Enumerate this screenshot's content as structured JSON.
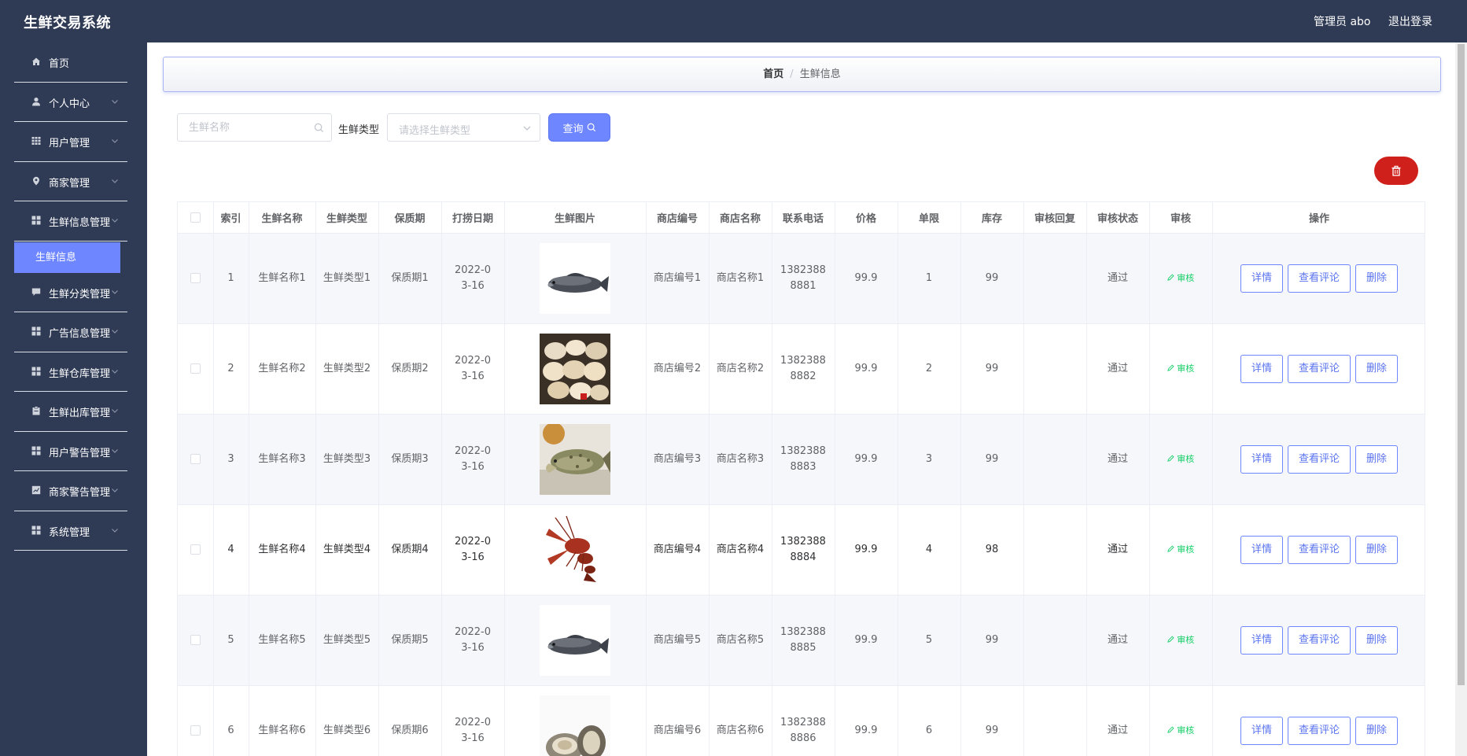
{
  "header": {
    "title": "生鲜交易系统",
    "user": "管理员 abo",
    "logout": "退出登录"
  },
  "sidebar": {
    "items": [
      {
        "label": "首页",
        "icon": "home-icon"
      },
      {
        "label": "个人中心",
        "icon": "user-icon"
      },
      {
        "label": "用户管理",
        "icon": "grid-icon"
      },
      {
        "label": "商家管理",
        "icon": "location-icon"
      },
      {
        "label": "生鲜信息管理",
        "icon": "menu-icon"
      },
      {
        "label": "生鲜分类管理",
        "icon": "chat-icon"
      },
      {
        "label": "广告信息管理",
        "icon": "menu-icon"
      },
      {
        "label": "生鲜仓库管理",
        "icon": "menu-icon"
      },
      {
        "label": "生鲜出库管理",
        "icon": "clipboard-icon"
      },
      {
        "label": "用户警告管理",
        "icon": "menu-icon"
      },
      {
        "label": "商家警告管理",
        "icon": "chart-icon"
      },
      {
        "label": "系统管理",
        "icon": "menu-icon"
      }
    ],
    "active_sub": "生鲜信息"
  },
  "breadcrumb": {
    "home": "首页",
    "sep": "/",
    "current": "生鲜信息"
  },
  "search": {
    "name_placeholder": "生鲜名称",
    "type_label": "生鲜类型",
    "type_placeholder": "请选择生鲜类型",
    "query_label": "查询"
  },
  "table": {
    "headers": [
      "",
      "索引",
      "生鲜名称",
      "生鲜类型",
      "保质期",
      "打捞日期",
      "生鲜图片",
      "商店编号",
      "商店名称",
      "联系电话",
      "价格",
      "单限",
      "库存",
      "审核回复",
      "审核状态",
      "审核",
      "操作"
    ],
    "actions": {
      "detail": "详情",
      "comments": "查看评论",
      "delete": "删除",
      "audit": "审核"
    },
    "rows": [
      {
        "index": "1",
        "name": "生鲜名称1",
        "type": "生鲜类型1",
        "shelf": "保质期1",
        "date": "2022-03-16",
        "image": "fish",
        "shop_no": "商店编号1",
        "shop_name": "商店名称1",
        "phone": "13823888881",
        "price": "99.9",
        "limit": "1",
        "stock": "99",
        "reply": "",
        "status": "通过"
      },
      {
        "index": "2",
        "name": "生鲜名称2",
        "type": "生鲜类型2",
        "shelf": "保质期2",
        "date": "2022-03-16",
        "image": "clams",
        "shop_no": "商店编号2",
        "shop_name": "商店名称2",
        "phone": "13823888882",
        "price": "99.9",
        "limit": "2",
        "stock": "99",
        "reply": "",
        "status": "通过"
      },
      {
        "index": "3",
        "name": "生鲜名称3",
        "type": "生鲜类型3",
        "shelf": "保质期3",
        "date": "2022-03-16",
        "image": "grouper",
        "shop_no": "商店编号3",
        "shop_name": "商店名称3",
        "phone": "13823888883",
        "price": "99.9",
        "limit": "3",
        "stock": "99",
        "reply": "",
        "status": "通过"
      },
      {
        "index": "4",
        "name": "生鲜名称4",
        "type": "生鲜类型4",
        "shelf": "保质期4",
        "date": "2022-03-16",
        "image": "crayfish",
        "shop_no": "商店编号4",
        "shop_name": "商店名称4",
        "phone": "13823888884",
        "price": "99.9",
        "limit": "4",
        "stock": "98",
        "reply": "",
        "status": "通过"
      },
      {
        "index": "5",
        "name": "生鲜名称5",
        "type": "生鲜类型5",
        "shelf": "保质期5",
        "date": "2022-03-16",
        "image": "fish",
        "shop_no": "商店编号5",
        "shop_name": "商店名称5",
        "phone": "13823888885",
        "price": "99.9",
        "limit": "5",
        "stock": "99",
        "reply": "",
        "status": "通过"
      },
      {
        "index": "6",
        "name": "生鲜名称6",
        "type": "生鲜类型6",
        "shelf": "保质期6",
        "date": "2022-03-16",
        "image": "oyster",
        "shop_no": "商店编号6",
        "shop_name": "商店名称6",
        "phone": "13823888886",
        "price": "99.9",
        "limit": "6",
        "stock": "99",
        "reply": "",
        "status": "通过"
      }
    ]
  },
  "colors": {
    "nav_bg": "#2f3a55",
    "accent": "#6e86ff",
    "danger": "#d0201b",
    "audit": "#13ce66"
  }
}
